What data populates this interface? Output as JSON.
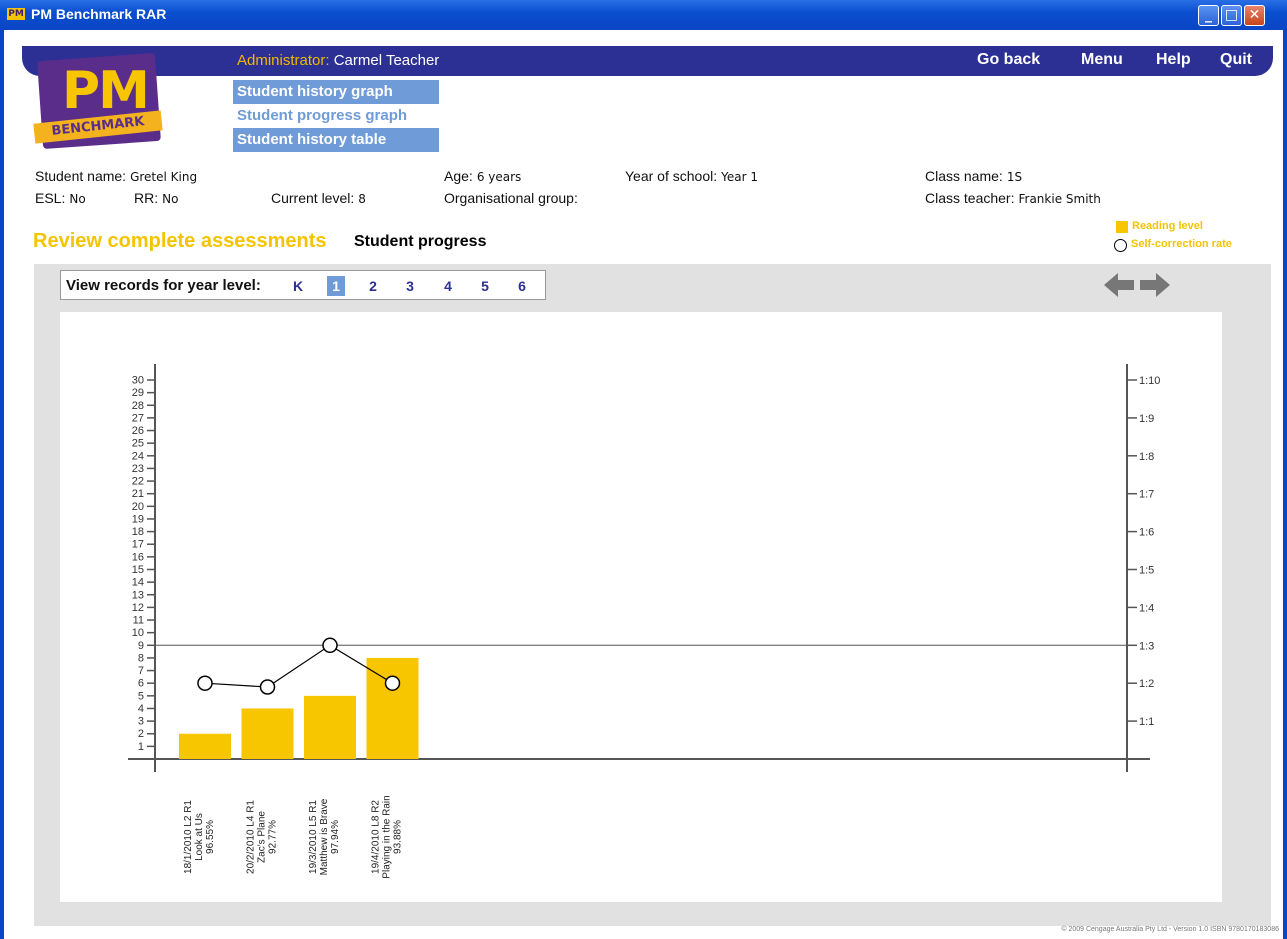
{
  "window": {
    "title": "PM Benchmark RAR",
    "app_icon": "PM"
  },
  "nav": {
    "admin_label": "Administrator:",
    "admin_name": "Carmel Teacher",
    "go_back": "Go back",
    "menu": "Menu",
    "help": "Help",
    "quit": "Quit"
  },
  "logo": {
    "pm": "PM",
    "benchmark": "BENCHMARK"
  },
  "submenu": [
    "Student history graph",
    "Student progress graph",
    "Student history table"
  ],
  "student": {
    "name_label": "Student name:",
    "name": "Gretel King",
    "age_label": "Age:",
    "age": "6 years",
    "year_label": "Year of school:",
    "year": "Year 1",
    "class_label": "Class name:",
    "class": "1S",
    "esl_label": "ESL:",
    "esl": "No",
    "rr_label": "RR:",
    "rr": "No",
    "level_label": "Current level:",
    "level": "8",
    "org_label": "Organisational group:",
    "org": "",
    "teacher_label": "Class teacher:",
    "teacher": "Frankie Smith"
  },
  "page": {
    "heading": "Review complete assessments",
    "subheading": "Student progress"
  },
  "legend": {
    "reading": "Reading level",
    "scr": "Self-correction rate"
  },
  "year_selector": {
    "label": "View records for year level:",
    "levels": [
      "K",
      "1",
      "2",
      "3",
      "4",
      "5",
      "6"
    ],
    "selected": "1"
  },
  "colors": {
    "bar": "#f7c600",
    "nav": "#2c2f94",
    "submenu": "#6f9bd8"
  },
  "chart_data": {
    "type": "bar",
    "y_left": {
      "min": 0,
      "max": 30,
      "ticks": [
        1,
        2,
        3,
        4,
        5,
        6,
        7,
        8,
        9,
        10,
        11,
        12,
        13,
        14,
        15,
        16,
        17,
        18,
        19,
        20,
        21,
        22,
        23,
        24,
        25,
        26,
        27,
        28,
        29,
        30
      ]
    },
    "y_right": {
      "ticks": [
        "1:1",
        "1:2",
        "1:3",
        "1:4",
        "1:5",
        "1:6",
        "1:7",
        "1:8",
        "1:9",
        "1:10"
      ]
    },
    "reference_line_level": 9,
    "categories": [
      [
        "18/1/2010 L2 R1",
        "Look at Us",
        "96.55%"
      ],
      [
        "20/2/2010 L4 R1",
        "Zac's Plane",
        "92.77%"
      ],
      [
        "19/3/2010 L5 R1",
        "Matthew is Brave",
        "97.94%"
      ],
      [
        "19/4/2010 L8 R2",
        "Playing in the Rain",
        "93.88%"
      ]
    ],
    "series": [
      {
        "name": "Reading level",
        "type": "bar",
        "values": [
          2,
          4,
          5,
          8
        ]
      },
      {
        "name": "Self-correction rate",
        "type": "line",
        "values": [
          6,
          5.7,
          9,
          6
        ]
      }
    ]
  },
  "copyright": "© 2009 Cengage Australia Pty Ltd - Version 1.0 ISBN 9780170183086"
}
